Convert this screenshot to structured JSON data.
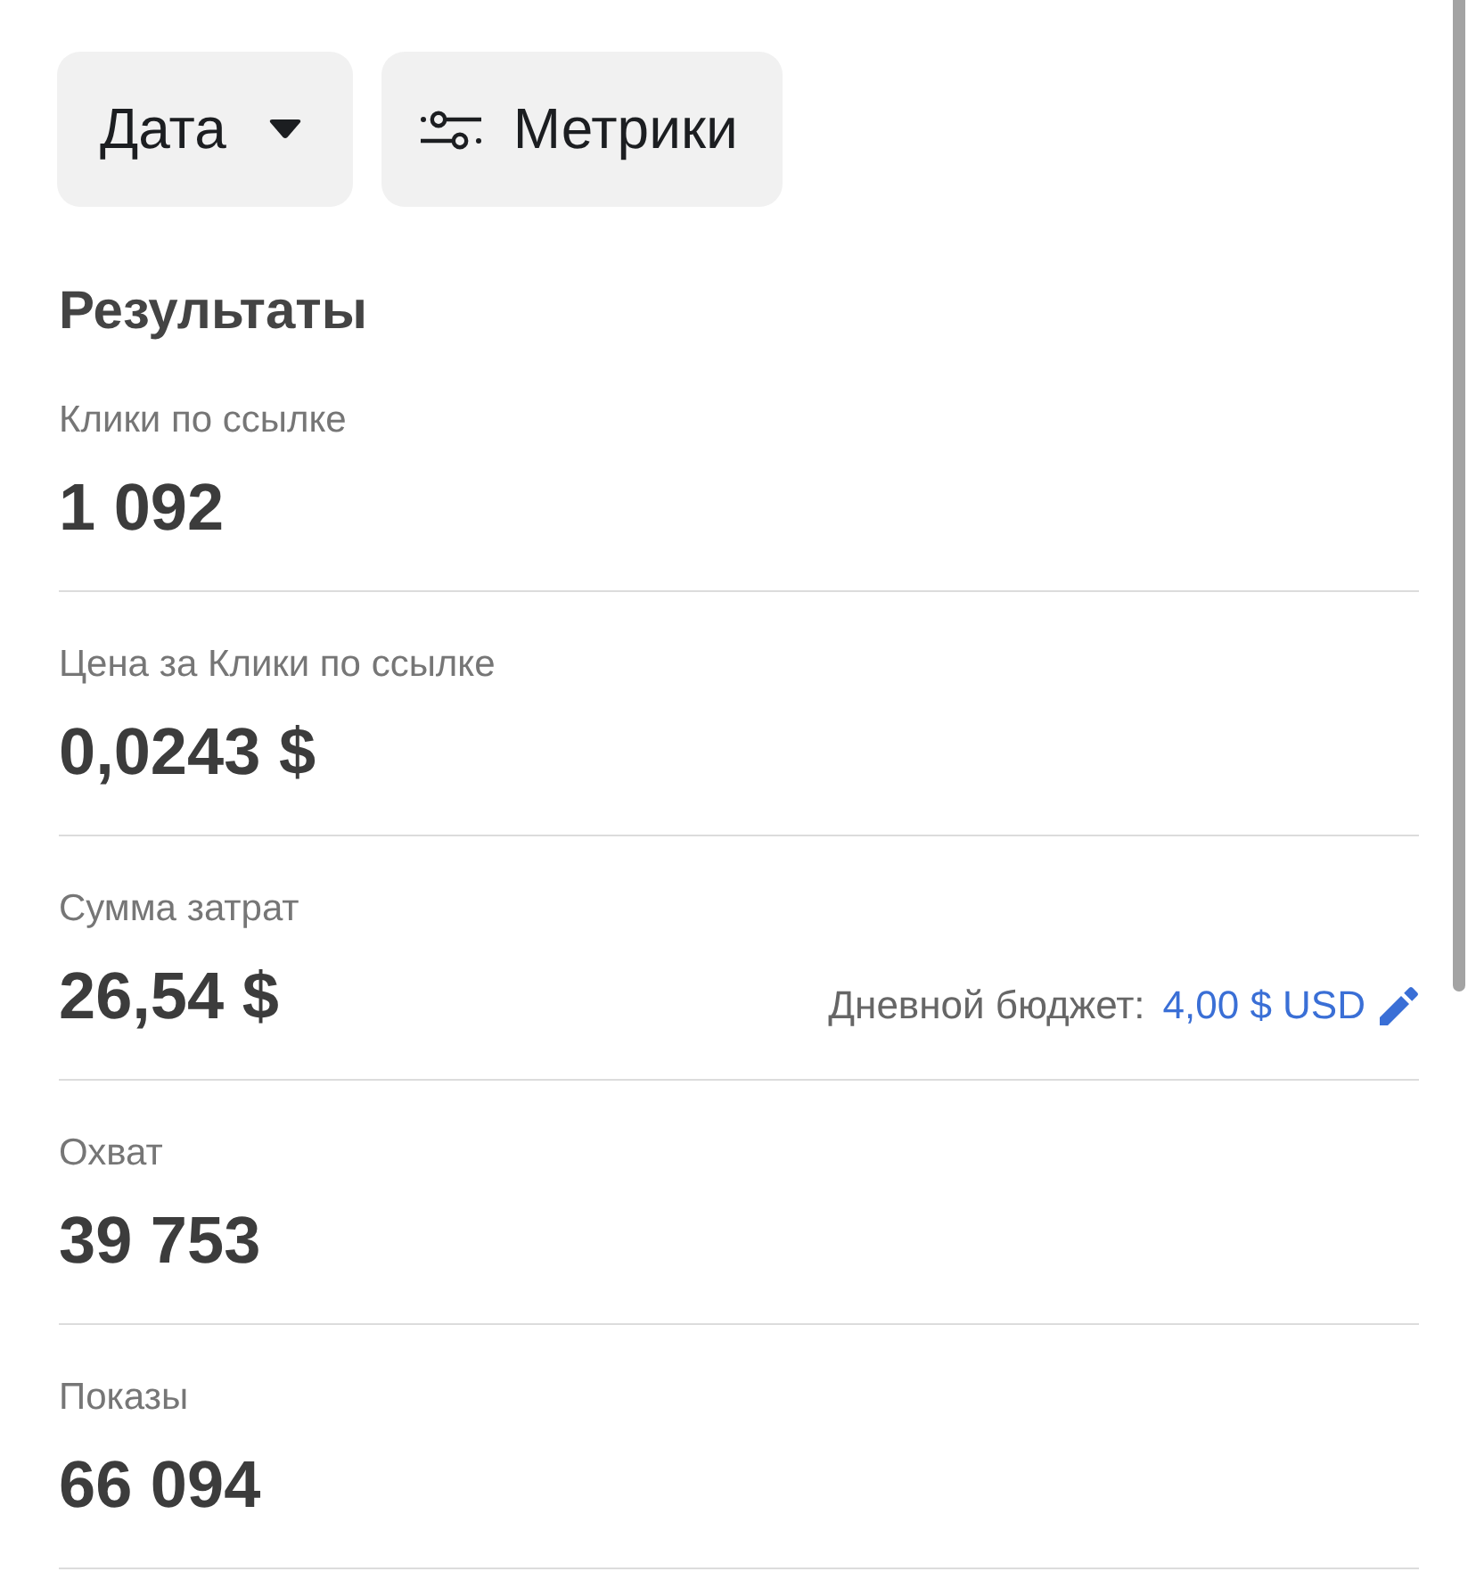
{
  "filters": [
    {
      "kind": "dropdown",
      "label": "Дата"
    },
    {
      "kind": "metrics",
      "label": "Метрики"
    }
  ],
  "results": {
    "title": "Результаты",
    "metrics": [
      {
        "label": "Клики по ссылке",
        "value": "1 092"
      },
      {
        "label": "Цена за Клики по ссылке",
        "value": "0,0243 $"
      },
      {
        "label": "Сумма затрат",
        "value": "26,54 $",
        "budget": {
          "label": "Дневной бюджет:",
          "amount": "4,00 $ USD"
        }
      },
      {
        "label": "Охват",
        "value": "39 753"
      },
      {
        "label": "Показы",
        "value": "66 094"
      }
    ]
  }
}
